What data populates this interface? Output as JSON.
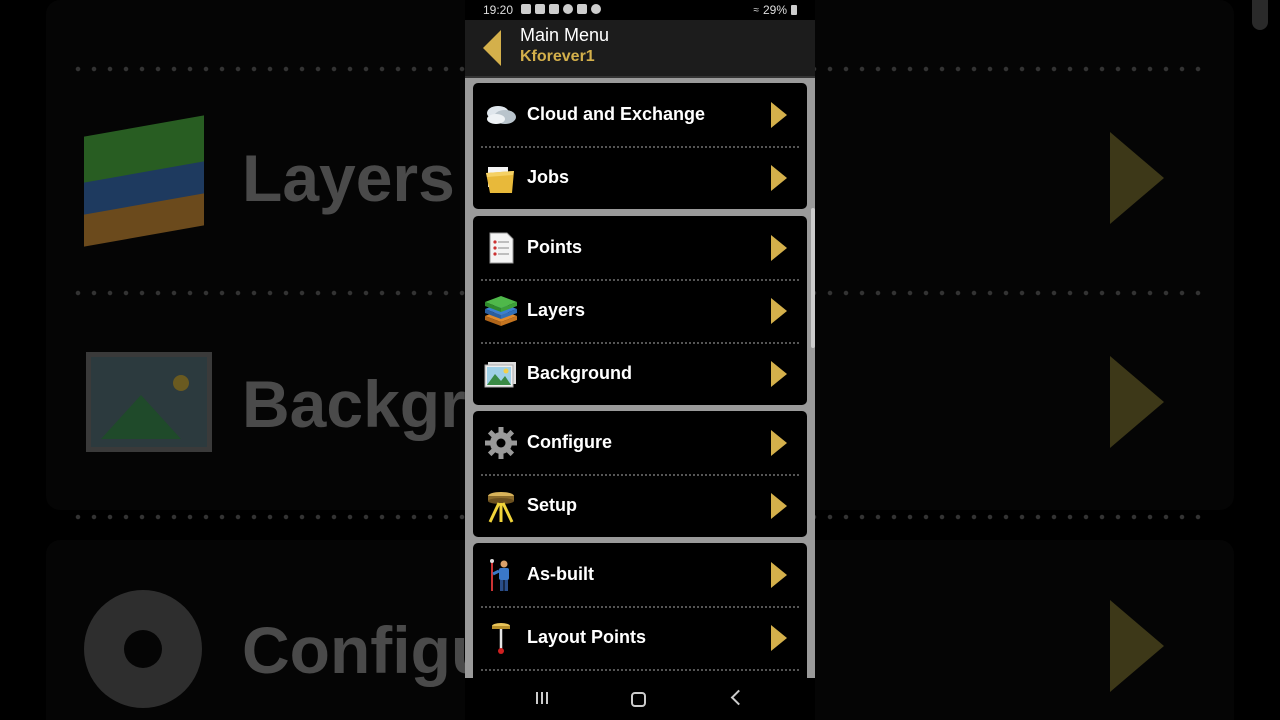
{
  "status_bar": {
    "time": "19:20",
    "battery": "29%"
  },
  "header": {
    "title": "Main Menu",
    "subtitle": "Kforever1"
  },
  "menu_groups": [
    {
      "items": [
        {
          "label": "Cloud and Exchange",
          "icon": "cloud-icon"
        },
        {
          "label": "Jobs",
          "icon": "folder-icon"
        }
      ]
    },
    {
      "items": [
        {
          "label": "Points",
          "icon": "points-document-icon"
        },
        {
          "label": "Layers",
          "icon": "layers-icon"
        },
        {
          "label": "Background",
          "icon": "landscape-image-icon"
        }
      ]
    },
    {
      "items": [
        {
          "label": "Configure",
          "icon": "gear-icon"
        },
        {
          "label": "Setup",
          "icon": "tripod-icon"
        }
      ]
    },
    {
      "items": [
        {
          "label": "As-built",
          "icon": "surveyor-icon"
        },
        {
          "label": "Layout Points",
          "icon": "stake-icon"
        }
      ]
    }
  ],
  "background": {
    "labels": [
      "Layers",
      "Backgr",
      "Configu"
    ]
  },
  "colors": {
    "accent": "#d4b04b",
    "panel": "#000000",
    "list_bg": "#9a9a9a"
  }
}
